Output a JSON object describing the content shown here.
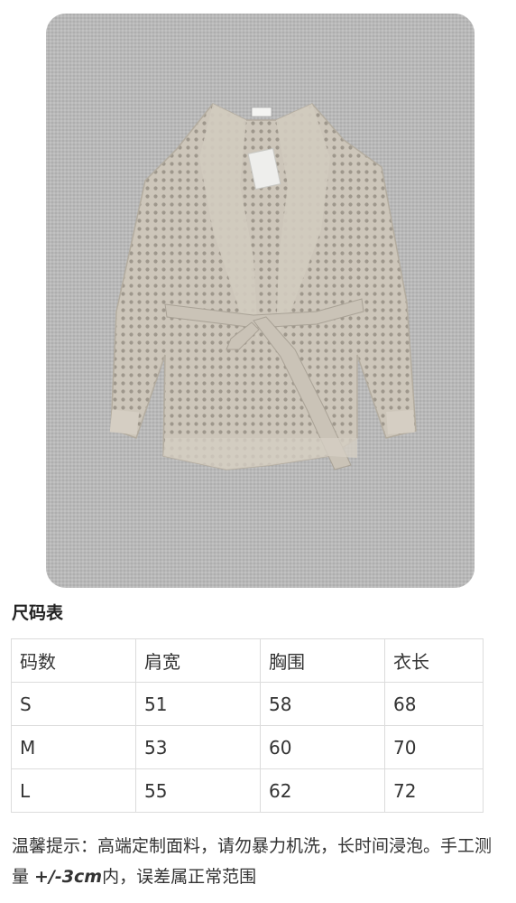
{
  "product_image": {
    "description_icon": "knit-cardigan-photo",
    "background_color": "#bcbcbc",
    "garment_color": "#cfc8bd",
    "tag_color": "#eeeeec"
  },
  "size_chart": {
    "title": "尺码表",
    "headers": [
      "码数",
      "肩宽",
      "胸围",
      "衣长"
    ],
    "rows": [
      [
        "S",
        "51",
        "58",
        "68"
      ],
      [
        "M",
        "53",
        "60",
        "70"
      ],
      [
        "L",
        "55",
        "62",
        "72"
      ]
    ]
  },
  "notice": {
    "part1": "温馨提示：高端定制面料，请勿暴力机洗，长时间浸泡。手工测量 ",
    "tolerance": "+/-3cm",
    "part2": "内，误差属正常范围"
  }
}
